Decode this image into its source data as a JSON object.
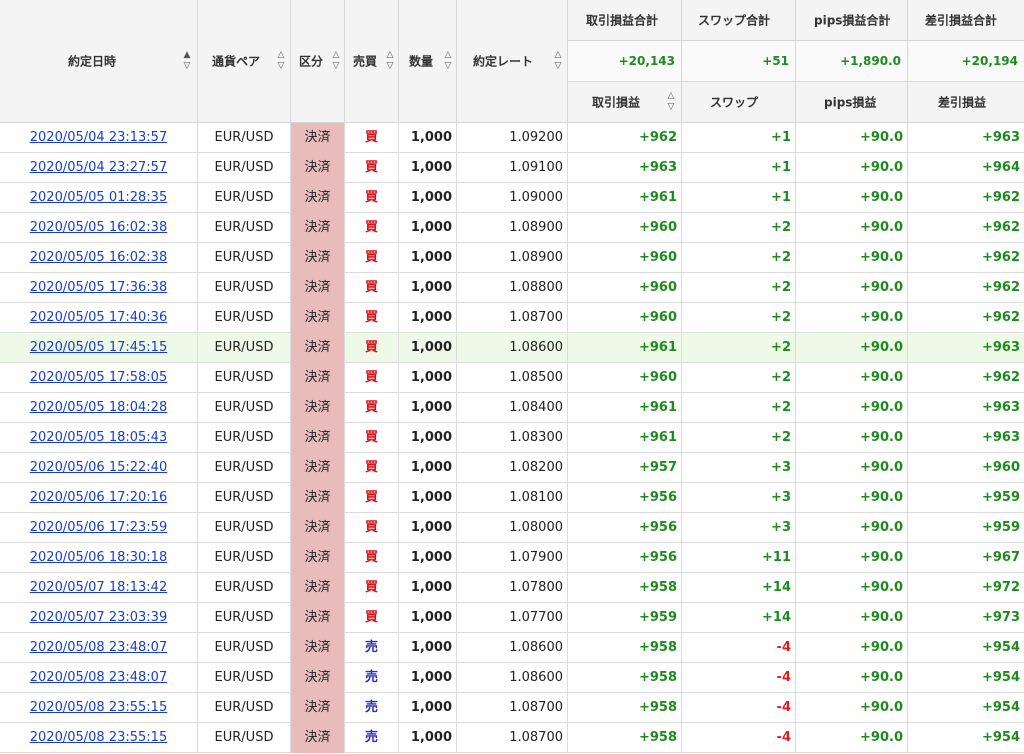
{
  "header": {
    "date": "約定日時",
    "pair": "通貨ペア",
    "kubun": "区分",
    "side": "売買",
    "qty": "数量",
    "rate": "約定レート",
    "pl_total_label": "取引損益合計",
    "swap_total_label": "スワップ合計",
    "pips_total_label": "pips損益合計",
    "net_total_label": "差引損益合計",
    "pl_total": "+20,143",
    "swap_total": "+51",
    "pips_total": "+1,890.0",
    "net_total": "+20,194",
    "pl": "取引損益",
    "swap": "スワップ",
    "pips": "pips損益",
    "net": "差引損益",
    "sort_up": "▲",
    "sort_up_outline": "△",
    "sort_down": "▽"
  },
  "colors": {
    "buy": "#d0141a",
    "sell": "#2b2fb5",
    "profit": "#1f8a1f",
    "loss": "#e02020",
    "kubun_bg": "#e9bcbc",
    "highlight_row": "#eef9e7"
  },
  "rows": [
    {
      "date": "2020/05/04 23:13:57",
      "pair": "EUR/USD",
      "kubun": "決済",
      "side": "買",
      "qty": "1,000",
      "rate": "1.09200",
      "pl": "+962",
      "swap": "+1",
      "pips": "+90.0",
      "net": "+963"
    },
    {
      "date": "2020/05/04 23:27:57",
      "pair": "EUR/USD",
      "kubun": "決済",
      "side": "買",
      "qty": "1,000",
      "rate": "1.09100",
      "pl": "+963",
      "swap": "+1",
      "pips": "+90.0",
      "net": "+964"
    },
    {
      "date": "2020/05/05 01:28:35",
      "pair": "EUR/USD",
      "kubun": "決済",
      "side": "買",
      "qty": "1,000",
      "rate": "1.09000",
      "pl": "+961",
      "swap": "+1",
      "pips": "+90.0",
      "net": "+962"
    },
    {
      "date": "2020/05/05 16:02:38",
      "pair": "EUR/USD",
      "kubun": "決済",
      "side": "買",
      "qty": "1,000",
      "rate": "1.08900",
      "pl": "+960",
      "swap": "+2",
      "pips": "+90.0",
      "net": "+962"
    },
    {
      "date": "2020/05/05 16:02:38",
      "pair": "EUR/USD",
      "kubun": "決済",
      "side": "買",
      "qty": "1,000",
      "rate": "1.08900",
      "pl": "+960",
      "swap": "+2",
      "pips": "+90.0",
      "net": "+962"
    },
    {
      "date": "2020/05/05 17:36:38",
      "pair": "EUR/USD",
      "kubun": "決済",
      "side": "買",
      "qty": "1,000",
      "rate": "1.08800",
      "pl": "+960",
      "swap": "+2",
      "pips": "+90.0",
      "net": "+962"
    },
    {
      "date": "2020/05/05 17:40:36",
      "pair": "EUR/USD",
      "kubun": "決済",
      "side": "買",
      "qty": "1,000",
      "rate": "1.08700",
      "pl": "+960",
      "swap": "+2",
      "pips": "+90.0",
      "net": "+962"
    },
    {
      "date": "2020/05/05 17:45:15",
      "pair": "EUR/USD",
      "kubun": "決済",
      "side": "買",
      "qty": "1,000",
      "rate": "1.08600",
      "pl": "+961",
      "swap": "+2",
      "pips": "+90.0",
      "net": "+963",
      "highlight": true
    },
    {
      "date": "2020/05/05 17:58:05",
      "pair": "EUR/USD",
      "kubun": "決済",
      "side": "買",
      "qty": "1,000",
      "rate": "1.08500",
      "pl": "+960",
      "swap": "+2",
      "pips": "+90.0",
      "net": "+962"
    },
    {
      "date": "2020/05/05 18:04:28",
      "pair": "EUR/USD",
      "kubun": "決済",
      "side": "買",
      "qty": "1,000",
      "rate": "1.08400",
      "pl": "+961",
      "swap": "+2",
      "pips": "+90.0",
      "net": "+963"
    },
    {
      "date": "2020/05/05 18:05:43",
      "pair": "EUR/USD",
      "kubun": "決済",
      "side": "買",
      "qty": "1,000",
      "rate": "1.08300",
      "pl": "+961",
      "swap": "+2",
      "pips": "+90.0",
      "net": "+963"
    },
    {
      "date": "2020/05/06 15:22:40",
      "pair": "EUR/USD",
      "kubun": "決済",
      "side": "買",
      "qty": "1,000",
      "rate": "1.08200",
      "pl": "+957",
      "swap": "+3",
      "pips": "+90.0",
      "net": "+960"
    },
    {
      "date": "2020/05/06 17:20:16",
      "pair": "EUR/USD",
      "kubun": "決済",
      "side": "買",
      "qty": "1,000",
      "rate": "1.08100",
      "pl": "+956",
      "swap": "+3",
      "pips": "+90.0",
      "net": "+959"
    },
    {
      "date": "2020/05/06 17:23:59",
      "pair": "EUR/USD",
      "kubun": "決済",
      "side": "買",
      "qty": "1,000",
      "rate": "1.08000",
      "pl": "+956",
      "swap": "+3",
      "pips": "+90.0",
      "net": "+959"
    },
    {
      "date": "2020/05/06 18:30:18",
      "pair": "EUR/USD",
      "kubun": "決済",
      "side": "買",
      "qty": "1,000",
      "rate": "1.07900",
      "pl": "+956",
      "swap": "+11",
      "pips": "+90.0",
      "net": "+967"
    },
    {
      "date": "2020/05/07 18:13:42",
      "pair": "EUR/USD",
      "kubun": "決済",
      "side": "買",
      "qty": "1,000",
      "rate": "1.07800",
      "pl": "+958",
      "swap": "+14",
      "pips": "+90.0",
      "net": "+972"
    },
    {
      "date": "2020/05/07 23:03:39",
      "pair": "EUR/USD",
      "kubun": "決済",
      "side": "買",
      "qty": "1,000",
      "rate": "1.07700",
      "pl": "+959",
      "swap": "+14",
      "pips": "+90.0",
      "net": "+973"
    },
    {
      "date": "2020/05/08 23:48:07",
      "pair": "EUR/USD",
      "kubun": "決済",
      "side": "売",
      "qty": "1,000",
      "rate": "1.08600",
      "pl": "+958",
      "swap": "-4",
      "pips": "+90.0",
      "net": "+954"
    },
    {
      "date": "2020/05/08 23:48:07",
      "pair": "EUR/USD",
      "kubun": "決済",
      "side": "売",
      "qty": "1,000",
      "rate": "1.08600",
      "pl": "+958",
      "swap": "-4",
      "pips": "+90.0",
      "net": "+954"
    },
    {
      "date": "2020/05/08 23:55:15",
      "pair": "EUR/USD",
      "kubun": "決済",
      "side": "売",
      "qty": "1,000",
      "rate": "1.08700",
      "pl": "+958",
      "swap": "-4",
      "pips": "+90.0",
      "net": "+954"
    },
    {
      "date": "2020/05/08 23:55:15",
      "pair": "EUR/USD",
      "kubun": "決済",
      "side": "売",
      "qty": "1,000",
      "rate": "1.08700",
      "pl": "+958",
      "swap": "-4",
      "pips": "+90.0",
      "net": "+954"
    }
  ]
}
